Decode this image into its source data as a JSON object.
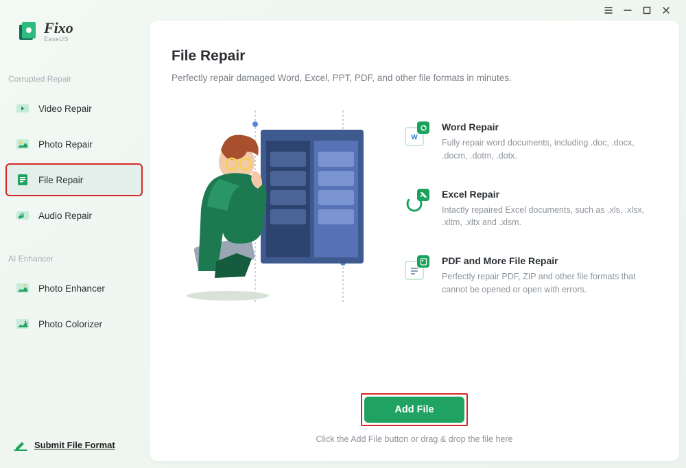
{
  "app": {
    "name": "Fixo",
    "vendor": "EaseUS"
  },
  "sidebar": {
    "sections": [
      {
        "label": "Corrupted Repair",
        "items": [
          {
            "label": "Video Repair",
            "icon": "video-icon",
            "color": "#20b46a"
          },
          {
            "label": "Photo Repair",
            "icon": "photo-icon",
            "color": "#20b46a"
          },
          {
            "label": "File Repair",
            "icon": "file-icon",
            "color": "#20b46a"
          },
          {
            "label": "Audio Repair",
            "icon": "audio-icon",
            "color": "#20b46a"
          }
        ]
      },
      {
        "label": "AI Enhancer",
        "items": [
          {
            "label": "Photo Enhancer",
            "icon": "enhance-icon",
            "color": "#20b46a"
          },
          {
            "label": "Photo Colorizer",
            "icon": "colorize-icon",
            "color": "#20b46a"
          }
        ]
      }
    ]
  },
  "submit_link": "Submit File Format",
  "main": {
    "title": "File Repair",
    "subtitle": "Perfectly repair damaged Word, Excel, PPT, PDF, and other file formats in minutes.",
    "features": [
      {
        "title": "Word Repair",
        "desc": "Fully repair word documents, including .doc, .docx, .docm, .dotm, .dotx."
      },
      {
        "title": "Excel Repair",
        "desc": "Intactly repaired Excel documents, such as .xls, .xlsx, .xltm, .xltx and .xlsm."
      },
      {
        "title": "PDF and More File Repair",
        "desc": "Perfectly repair PDF, ZIP and other file formats that cannot be opened or open with errors."
      }
    ],
    "action": {
      "button": "Add File",
      "hint": "Click the Add File button or drag & drop the file here"
    }
  }
}
